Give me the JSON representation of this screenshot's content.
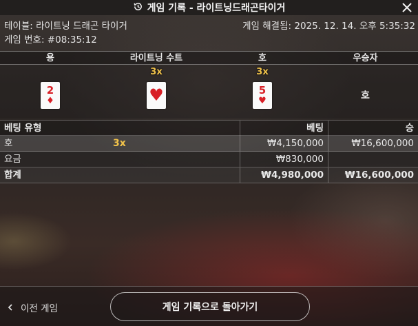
{
  "header": {
    "title": "게임 기록 - 라이트닝드래곤타이거"
  },
  "meta": {
    "table_label": "테이블: 라이트닝 드래곤 타이거",
    "game_number": "게임 번호: #08:35:12",
    "resolved": "게임 해결됨: 2025. 12. 14. 오후 5:35:32"
  },
  "outcome": {
    "headers": [
      "용",
      "라이트닝 수트",
      "호",
      "우승자"
    ],
    "dragon_card": {
      "rank": "2",
      "suit": "♦"
    },
    "lightning_suit": {
      "multiplier": "3x",
      "suit": "♥"
    },
    "tiger_card": {
      "rank": "5",
      "suit": "♥",
      "multiplier": "3x"
    },
    "winner": "호"
  },
  "bets": {
    "headers": [
      "베팅 유형",
      "베팅",
      "승"
    ],
    "rows": [
      {
        "type": "호",
        "multiplier": "3x",
        "bet": "₩4,150,000",
        "win": "₩16,600,000"
      },
      {
        "type": "요금",
        "multiplier": "",
        "bet": "₩830,000",
        "win": ""
      },
      {
        "type": "합계",
        "multiplier": "",
        "bet": "₩4,980,000",
        "win": "₩16,600,000"
      }
    ]
  },
  "footer": {
    "prev_game": "이전 게임",
    "back_button": "게임 기록으로 돌아가기"
  },
  "colors": {
    "card_red": "#d81f26",
    "multiplier_gold": "#f0c24a"
  },
  "icons": {
    "title_icon": "history-icon",
    "close": "close-icon",
    "prev": "chevron-left-icon"
  }
}
